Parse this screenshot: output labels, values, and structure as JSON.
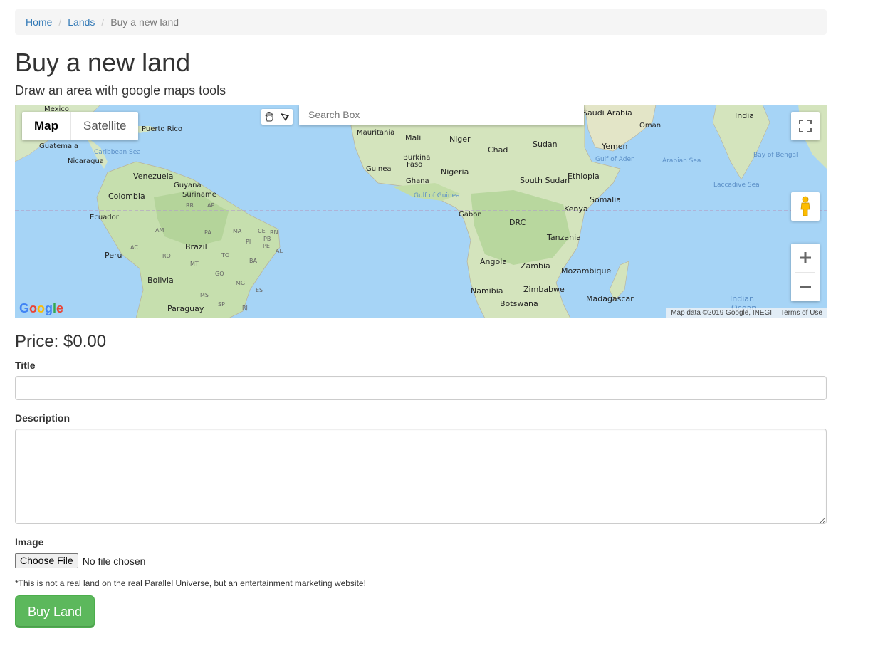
{
  "breadcrumb": {
    "home": "Home",
    "lands": "Lands",
    "current": "Buy a new land"
  },
  "page": {
    "title": "Buy a new land",
    "subtitle": "Draw an area with google maps tools"
  },
  "map": {
    "type_map": "Map",
    "type_satellite": "Satellite",
    "search_placeholder": "Search Box",
    "logo": "Google",
    "attribution": "Map data ©2019 Google, INEGI",
    "terms": "Terms of Use",
    "land_color": "#d6e6c3",
    "water_color": "#a6d4f6",
    "equator_color": "#b29fc7",
    "places": {
      "mexico": "Mexico",
      "puerto_rico": "Puerto Rico",
      "guatemala": "Guatemala",
      "nicaragua": "Nicaragua",
      "caribbean": "Caribbean Sea",
      "venezuela": "Venezuela",
      "colombia": "Colombia",
      "guyana": "Guyana",
      "suriname": "Suriname",
      "ecuador": "Ecuador",
      "peru": "Peru",
      "brazil": "Brazil",
      "bolivia": "Bolivia",
      "paraguay": "Paraguay",
      "rr": "RR",
      "ap": "AP",
      "am": "AM",
      "pa": "PA",
      "ma": "MA",
      "ce": "CE",
      "rn": "RN",
      "pi": "PI",
      "pb": "PB",
      "pe": "PE",
      "ac": "AC",
      "ro": "RO",
      "to": "TO",
      "al": "AL",
      "mt": "MT",
      "ba": "BA",
      "go": "GO",
      "mg": "MG",
      "es": "ES",
      "ms": "MS",
      "sp": "SP",
      "rj": "RJ",
      "mauritania": "Mauritania",
      "mali": "Mali",
      "niger": "Niger",
      "chad": "Chad",
      "sudan": "Sudan",
      "burkina": "Burkina",
      "faso": "Faso",
      "guinea": "Guinea",
      "nigeria": "Nigeria",
      "ghana": "Ghana",
      "gulf_guinea": "Gulf of Guinea",
      "gabon": "Gabon",
      "drc": "DRC",
      "south_sudan": "South Sudan",
      "ethiopia": "Ethiopia",
      "kenya": "Kenya",
      "somalia": "Somalia",
      "tanzania": "Tanzania",
      "angola": "Angola",
      "zambia": "Zambia",
      "mozambique": "Mozambique",
      "namibia": "Namibia",
      "zimbabwe": "Zimbabwe",
      "botswana": "Botswana",
      "madagascar": "Madagascar",
      "saudi": "Saudi Arabia",
      "yemen": "Yemen",
      "oman": "Oman",
      "gulf_aden": "Gulf of Aden",
      "arabian_sea": "Arabian Sea",
      "india": "India",
      "bay_bengal": "Bay of Bengal",
      "laccadive": "Laccadive Sea",
      "indian_ocean": "Indian",
      "ocean": "Ocean"
    }
  },
  "form": {
    "price_label": "Price: $0.00",
    "title_label": "Title",
    "title_value": "",
    "description_label": "Description",
    "description_value": "",
    "image_label": "Image",
    "choose_file": "Choose File",
    "file_status": "No file chosen",
    "disclaimer": "*This is not a real land on the real Parallel Universe, but an entertainment marketing website!",
    "submit": "Buy Land",
    "submit_color": "#5cb85c"
  }
}
